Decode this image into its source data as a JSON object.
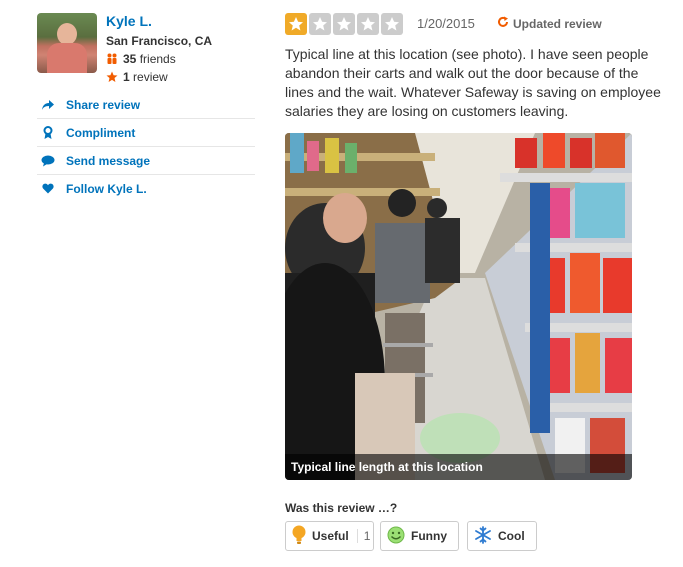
{
  "user": {
    "name": "Kyle L.",
    "location": "San Francisco, CA",
    "friends_count": "35",
    "friends_label": "friends",
    "reviews_count": "1",
    "reviews_label": "review"
  },
  "actions": [
    {
      "label": "Share review",
      "icon": "share-icon"
    },
    {
      "label": "Compliment",
      "icon": "compliment-icon"
    },
    {
      "label": "Send message",
      "icon": "message-icon"
    },
    {
      "label": "Follow Kyle L.",
      "icon": "heart-icon"
    }
  ],
  "review": {
    "rating": 1,
    "max_rating": 5,
    "date": "1/20/2015",
    "updated_label": "Updated review",
    "text": "Typical line at this location (see photo).  I have seen people abandon their carts and walk out the door because of the lines and the wait.  Whatever Safeway is saving on employee salaries they are losing on customers leaving.",
    "photo_caption": "Typical line length at this location"
  },
  "feedback": {
    "question": "Was this review …?",
    "useful_label": "Useful",
    "useful_count": "1",
    "funny_label": "Funny",
    "cool_label": "Cool"
  },
  "colors": {
    "link": "#0073bb",
    "star_on": "#f0aa28",
    "star_off": "#cccccc",
    "updated_icon": "#f15c00"
  }
}
